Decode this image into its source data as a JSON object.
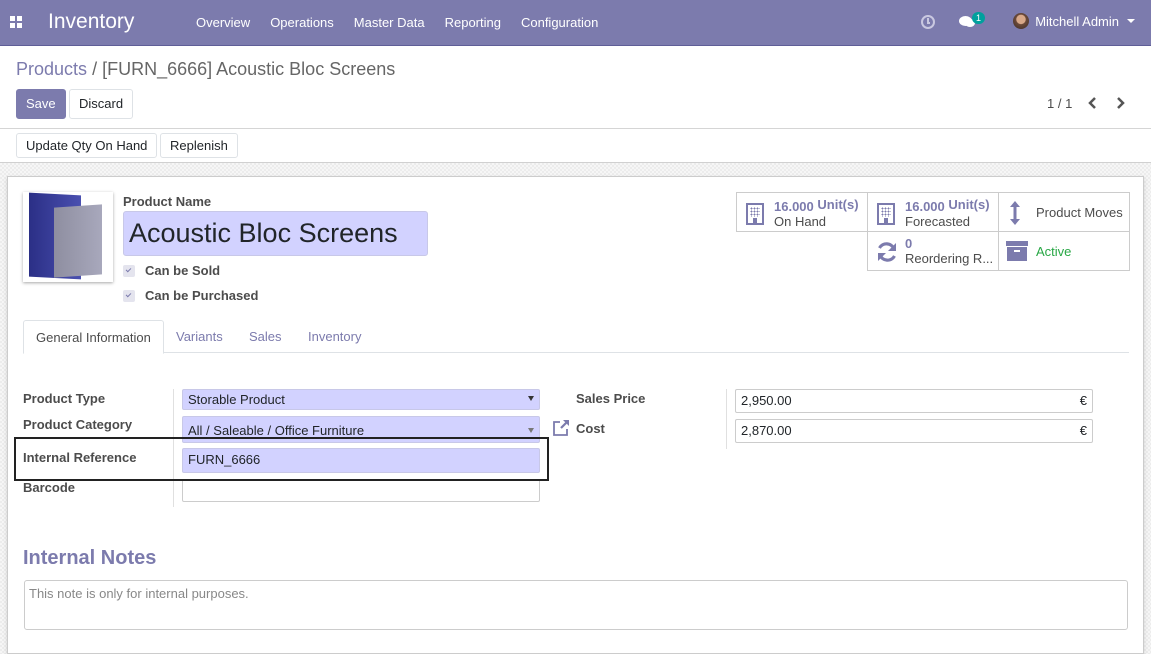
{
  "navbar": {
    "app_title": "Inventory",
    "menu": [
      "Overview",
      "Operations",
      "Master Data",
      "Reporting",
      "Configuration"
    ],
    "chat_badge": "1",
    "user_name": "Mitchell Admin",
    "icons": {
      "apps": "apps-grid-icon",
      "activity": "clock-icon",
      "messages": "chat-icon",
      "user": "avatar"
    }
  },
  "breadcrumb": {
    "parent": "Products",
    "separator": "/",
    "current": "[FURN_6666] Acoustic Bloc Screens"
  },
  "toolbar": {
    "save_label": "Save",
    "discard_label": "Discard",
    "pager": "1 / 1",
    "update_qty_label": "Update Qty On Hand",
    "replenish_label": "Replenish"
  },
  "product": {
    "name_label": "Product Name",
    "name": "Acoustic Bloc Screens",
    "can_be_sold_label": "Can be Sold",
    "can_be_sold": true,
    "can_be_purchased_label": "Can be Purchased",
    "can_be_purchased": true
  },
  "smart_buttons": {
    "on_hand": {
      "value": "16.000",
      "unit": "Unit(s)",
      "label": "On Hand"
    },
    "forecasted": {
      "value": "16.000",
      "unit": "Unit(s)",
      "label": "Forecasted"
    },
    "moves": {
      "label": "Product Moves"
    },
    "reordering": {
      "value": "0",
      "label": "Reordering R..."
    },
    "active": {
      "label": "Active",
      "color": "#28a745"
    }
  },
  "tabs": [
    "General Information",
    "Variants",
    "Sales",
    "Inventory"
  ],
  "active_tab": "General Information",
  "general": {
    "product_type_label": "Product Type",
    "product_type": "Storable Product",
    "product_category_label": "Product Category",
    "product_category": "All / Saleable / Office Furniture",
    "internal_reference_label": "Internal Reference",
    "internal_reference": "FURN_6666",
    "barcode_label": "Barcode",
    "barcode": "",
    "sales_price_label": "Sales Price",
    "sales_price": "2,950.00",
    "cost_label": "Cost",
    "cost": "2,870.00",
    "currency": "€"
  },
  "notes": {
    "title": "Internal Notes",
    "placeholder": "This note is only for internal purposes."
  },
  "colors": {
    "brand": "#7c7bad",
    "required_field": "#d2d2ff",
    "active_status": "#28a745",
    "badge": "#00a09d"
  }
}
